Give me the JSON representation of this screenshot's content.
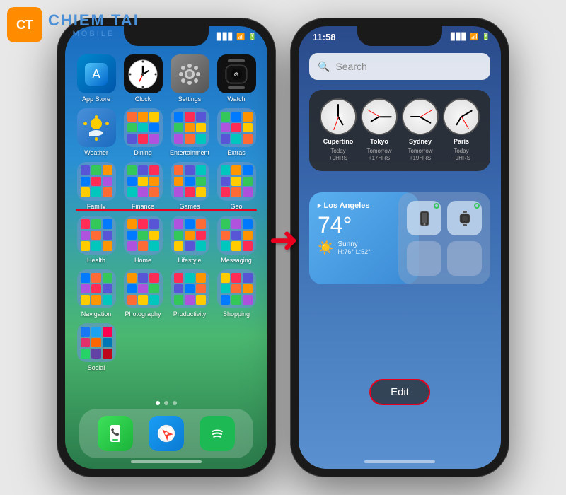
{
  "watermark": {
    "logo": "CT",
    "brand": "CHIEM TAI",
    "sub": "MOBILE"
  },
  "phone1": {
    "apps": [
      {
        "label": "App Store",
        "icon": "appstore"
      },
      {
        "label": "Clock",
        "icon": "clock"
      },
      {
        "label": "Settings",
        "icon": "settings"
      },
      {
        "label": "Watch",
        "icon": "watch"
      },
      {
        "label": "Weather",
        "icon": "weather"
      },
      {
        "label": "Dining",
        "icon": "folder"
      },
      {
        "label": "Entertainment",
        "icon": "folder"
      },
      {
        "label": "Extras",
        "icon": "folder"
      },
      {
        "label": "Family",
        "icon": "folder"
      },
      {
        "label": "Finance",
        "icon": "folder"
      },
      {
        "label": "Games",
        "icon": "folder"
      },
      {
        "label": "Geo",
        "icon": "folder"
      },
      {
        "label": "Health",
        "icon": "folder"
      },
      {
        "label": "Home",
        "icon": "folder"
      },
      {
        "label": "Lifestyle",
        "icon": "folder"
      },
      {
        "label": "Messaging",
        "icon": "folder"
      },
      {
        "label": "Navigation",
        "icon": "folder"
      },
      {
        "label": "Photography",
        "icon": "folder"
      },
      {
        "label": "Productivity",
        "icon": "folder"
      },
      {
        "label": "Shopping",
        "icon": "folder"
      },
      {
        "label": "Social",
        "icon": "folder"
      }
    ],
    "dock": [
      "Phone",
      "Safari",
      "Spotify"
    ]
  },
  "phone2": {
    "time": "11:58",
    "search_placeholder": "Search",
    "clocks": [
      {
        "city": "Cupertino",
        "day": "Today",
        "offset": "+0HRS",
        "hour_rot": 150,
        "min_rot": 0
      },
      {
        "city": "Tokyo",
        "day": "Tomorrow",
        "offset": "+17HRS",
        "hour_rot": 210,
        "min_rot": 90
      },
      {
        "city": "Sydney",
        "day": "Tomorrow",
        "offset": "+19HRS",
        "hour_rot": 240,
        "min_rot": 120
      },
      {
        "city": "Paris",
        "day": "Today",
        "offset": "+9HRS",
        "hour_rot": 180,
        "min_rot": 60
      }
    ],
    "weather": {
      "city": "Los Angeles",
      "temp": "74°",
      "condition": "Sunny",
      "high": "H:76°",
      "low": "L:52°"
    },
    "edit_label": "Edit"
  }
}
